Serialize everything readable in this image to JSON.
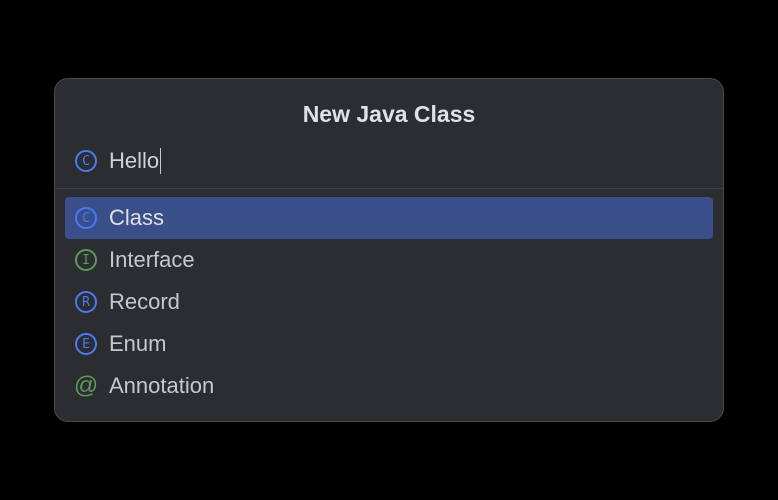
{
  "dialog": {
    "title": "New Java Class",
    "input": {
      "value": "Hello",
      "icon": "C"
    },
    "options": [
      {
        "icon": "C",
        "iconClass": "icon-class",
        "label": "Class",
        "selected": true
      },
      {
        "icon": "I",
        "iconClass": "icon-interface",
        "label": "Interface",
        "selected": false
      },
      {
        "icon": "R",
        "iconClass": "icon-record",
        "label": "Record",
        "selected": false
      },
      {
        "icon": "E",
        "iconClass": "icon-enum",
        "label": "Enum",
        "selected": false
      },
      {
        "icon": "@",
        "iconClass": "icon-annotation",
        "label": "Annotation",
        "selected": false
      }
    ]
  }
}
